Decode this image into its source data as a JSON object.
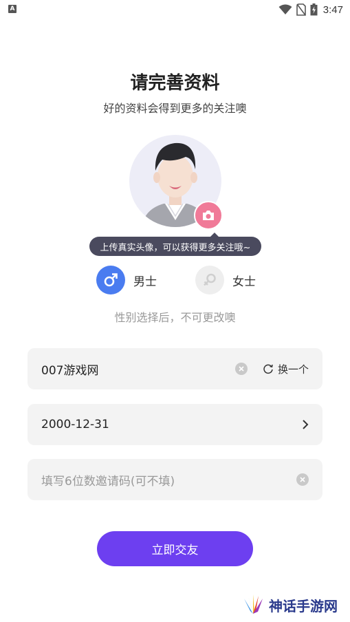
{
  "status_bar": {
    "left_icon": "A",
    "time": "3:47",
    "icons": [
      "wifi-icon",
      "no-sim-icon",
      "battery-charging-icon"
    ]
  },
  "header": {
    "title": "请完善资料",
    "subtitle": "好的资料会得到更多的关注噢"
  },
  "avatar": {
    "tooltip": "上传真实头像，可以获得更多关注哦~",
    "camera_icon": "camera-icon"
  },
  "gender": {
    "male_label": "男士",
    "female_label": "女士",
    "selected": "male",
    "note": "性别选择后，不可更改噢"
  },
  "form": {
    "nickname_value": "007游戏网",
    "swap_label": "换一个",
    "birthday_value": "2000-12-31",
    "invite_placeholder": "填写6位数邀请码(可不填)"
  },
  "submit_label": "立即交友",
  "watermark_text": "神话手游网",
  "colors": {
    "accent": "#6d3ff0",
    "male": "#4a7cf0",
    "camera": "#f07a98",
    "tooltip_bg": "#4a4a5e"
  }
}
